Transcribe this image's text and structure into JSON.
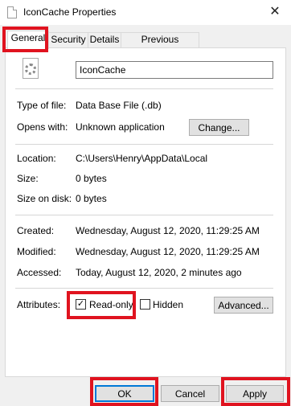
{
  "window": {
    "title": "IconCache Properties",
    "close_glyph": "✕"
  },
  "tabs": [
    {
      "label": "General",
      "active": true
    },
    {
      "label": "Security",
      "active": false
    },
    {
      "label": "Details",
      "active": false
    },
    {
      "label": "Previous Versions",
      "active": false
    }
  ],
  "file": {
    "name": "IconCache",
    "icon": "settings-file-icon"
  },
  "info": {
    "type_label": "Type of file:",
    "type_value": "Data Base File (.db)",
    "opens_label": "Opens with:",
    "opens_value": "Unknown application",
    "change_label": "Change...",
    "location_label": "Location:",
    "location_value": "C:\\Users\\Henry\\AppData\\Local",
    "size_label": "Size:",
    "size_value": "0 bytes",
    "size_disk_label": "Size on disk:",
    "size_disk_value": "0 bytes",
    "created_label": "Created:",
    "created_value": "Wednesday, August 12, 2020, 11:29:25 AM",
    "modified_label": "Modified:",
    "modified_value": "Wednesday, August 12, 2020, 11:29:25 AM",
    "accessed_label": "Accessed:",
    "accessed_value": "Today, August 12, 2020, 2 minutes ago"
  },
  "attributes": {
    "label": "Attributes:",
    "readonly_label": "Read-only",
    "readonly_checked": true,
    "hidden_label": "Hidden",
    "hidden_checked": false,
    "advanced_label": "Advanced...",
    "check_glyph": "✓"
  },
  "footer": {
    "ok_label": "OK",
    "cancel_label": "Cancel",
    "apply_label": "Apply"
  },
  "colors": {
    "highlight": "#e0131f",
    "focus_border": "#0078d7"
  }
}
